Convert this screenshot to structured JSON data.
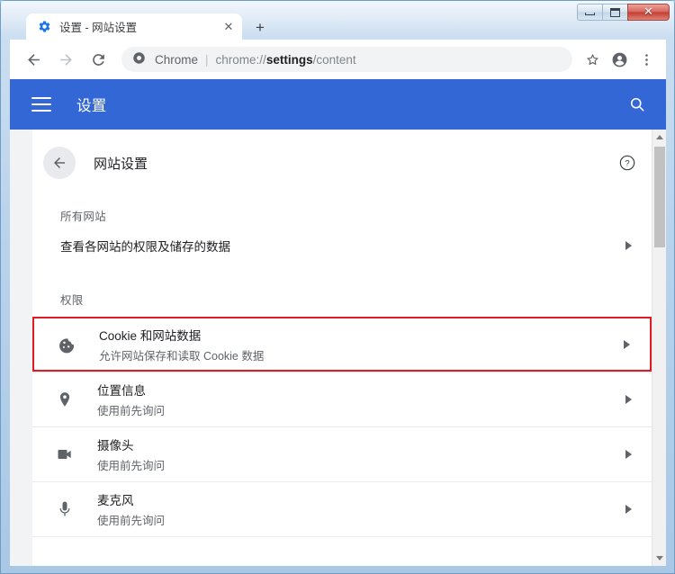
{
  "window": {
    "controls": {
      "minimize_label": "Minimize",
      "maximize_label": "Maximize",
      "close_label": "✕"
    }
  },
  "browser": {
    "tab": {
      "favicon": "gear-icon",
      "title": "设置 - 网站设置",
      "close_label": "✕"
    },
    "new_tab_label": "+",
    "toolbar": {
      "back_label": "←",
      "forward_label": "→",
      "reload_label": "⟳",
      "omnibox": {
        "security_chip": "Chrome",
        "separator": "|",
        "url_prefix": "chrome://",
        "url_bold": "settings",
        "url_suffix": "/content"
      },
      "bookmark_label": "☆",
      "profile_label": "profile-avatar",
      "menu_label": "⋮"
    }
  },
  "settings": {
    "header": {
      "menu_label": "menu",
      "title": "设置",
      "search_label": "search"
    },
    "section": {
      "back_label": "←",
      "title": "网站设置",
      "help_label": "?"
    },
    "groups": [
      {
        "label": "所有网站",
        "rows": [
          {
            "title": "查看各网站的权限及储存的数据",
            "sub": "",
            "icon": "none",
            "chevron": "▶"
          }
        ]
      },
      {
        "label": "权限",
        "rows": [
          {
            "title": "Cookie 和网站数据",
            "sub": "允许网站保存和读取 Cookie 数据",
            "icon": "cookie-icon",
            "chevron": "▶",
            "highlighted": true
          },
          {
            "title": "位置信息",
            "sub": "使用前先询问",
            "icon": "location-pin-icon",
            "chevron": "▶",
            "highlighted": false
          },
          {
            "title": "摄像头",
            "sub": "使用前先询问",
            "icon": "video-camera-icon",
            "chevron": "▶",
            "highlighted": false
          },
          {
            "title": "麦克风",
            "sub": "使用前先询问",
            "icon": "microphone-icon",
            "chevron": "▶",
            "highlighted": false
          }
        ]
      }
    ]
  },
  "colors": {
    "accent_blue": "#3367d6",
    "highlight_red": "#e01b24",
    "text_primary": "#202124",
    "text_secondary": "#5f6368"
  }
}
